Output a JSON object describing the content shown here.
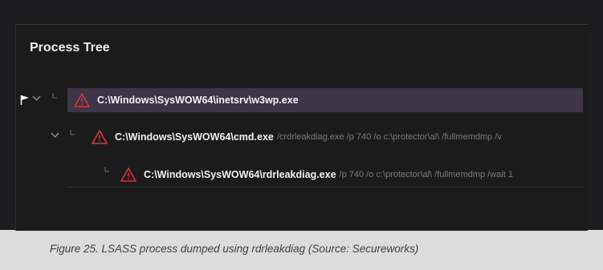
{
  "panel": {
    "title": "Process Tree"
  },
  "tree": [
    {
      "path": "C:\\Windows\\SysWOW64\\inetsrv\\w3wp.exe",
      "args": "",
      "icon": "warning-triangle-icon",
      "selected": true
    },
    {
      "path": "C:\\Windows\\SysWOW64\\cmd.exe",
      "args": "/crdrleakdiag.exe /p 740 /o c:\\protector\\al\\ /fullmemdmp /v",
      "icon": "warning-triangle-icon",
      "selected": false
    },
    {
      "path": "C:\\Windows\\SysWOW64\\rdrleakdiag.exe",
      "args": "/p 740 /o c:\\protector\\al\\ /fullmemdmp /wait 1",
      "icon": "warning-triangle-icon",
      "selected": false
    }
  ],
  "caption": "Figure 25. LSASS process dumped using rdrleakdiag (Source: Secureworks)",
  "colors": {
    "warning": "#e0323c",
    "selected_row": "#3d3548",
    "background": "#1d1d1f"
  }
}
